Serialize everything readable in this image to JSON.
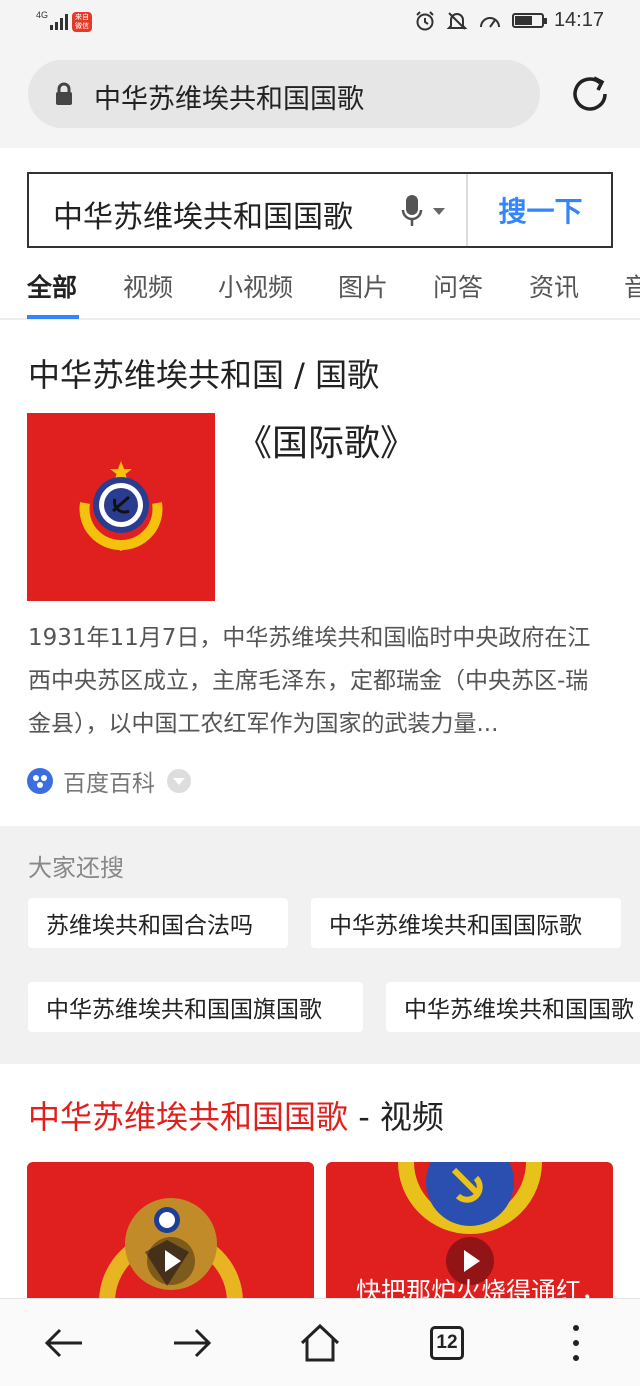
{
  "status_bar": {
    "network": "4G",
    "app_badge": "来自\n微信",
    "time": "14:17",
    "icons": [
      "alarm-icon",
      "mute-icon",
      "speed-icon",
      "battery-icon"
    ]
  },
  "browser": {
    "url_text": "中华苏维埃共和国国歌",
    "icons": {
      "lock": "lock-icon",
      "refresh": "refresh-icon"
    }
  },
  "search": {
    "query": "中华苏维埃共和国国歌",
    "button_label": "搜一下"
  },
  "tabs": [
    {
      "label": "全部",
      "active": true
    },
    {
      "label": "视频"
    },
    {
      "label": "小视频"
    },
    {
      "label": "图片"
    },
    {
      "label": "问答"
    },
    {
      "label": "资讯"
    },
    {
      "label": "音"
    }
  ],
  "result": {
    "title": "中华苏维埃共和国 / 国歌",
    "song": "《国际歌》",
    "description": "1931年11月7日，中华苏维埃共和国临时中央政府在江西中央苏区成立，主席毛泽东，定都瑞金（中央苏区-瑞金县），以中国工农红军作为国家的武装力量...",
    "source": "百度百科"
  },
  "related": {
    "heading": "大家还搜",
    "items": [
      "苏维埃共和国合法吗",
      "中华苏维埃共和国国际歌",
      "中华苏维埃共和国国旗国歌",
      "中华苏维埃共和国国歌"
    ]
  },
  "video": {
    "title_highlight": "中华苏维埃共和国国歌",
    "title_suffix": " - 视频",
    "caption": "快把那炉火烧得通红，"
  },
  "bottom_nav": {
    "tab_count": "12",
    "icons": [
      "back-arrow-icon",
      "forward-arrow-icon",
      "home-icon",
      "tabs-icon",
      "more-icon"
    ]
  },
  "colors": {
    "accent": "#3385ff",
    "red": "#e0201f"
  }
}
